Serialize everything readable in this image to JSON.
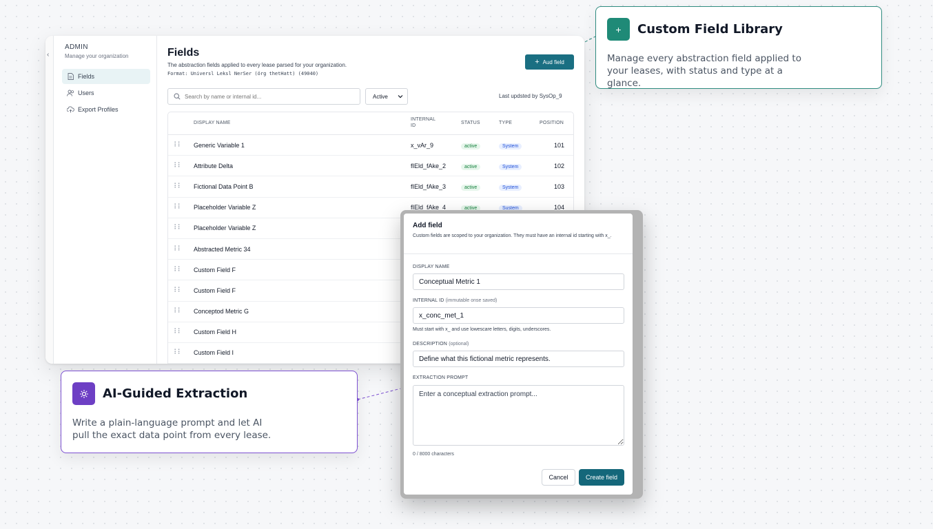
{
  "sidebar": {
    "title": "ADMIN",
    "subtitle": "Manage your organization",
    "items": [
      {
        "label": "Fields",
        "icon": "document-icon"
      },
      {
        "label": "Users",
        "icon": "users-icon"
      },
      {
        "label": "Export Profiles",
        "icon": "cloud-export-icon"
      }
    ]
  },
  "page": {
    "title": "Fields",
    "description": "The abstraction fields applied to every lease parsed for your organization.",
    "format": "Format: Universl Leksl NerSer (örg thetHatt) (49040)",
    "add_button": "Aud field",
    "search_placeholder": "Search by name or internal id...",
    "filter_value": "Active",
    "last_updated": "Last updsted by SysOp_9"
  },
  "table": {
    "headers": {
      "name": "DISPLAY NAME",
      "internal_id_line1": "INTERNAL",
      "internal_id_line2": "ID",
      "status": "STATUS",
      "type": "TYPE",
      "position": "POSITION"
    },
    "rows": [
      {
        "name": "Generic Variable 1",
        "id": "x_vAr_9",
        "status": "active",
        "type": "System",
        "position": "101"
      },
      {
        "name": "Attribute Delta",
        "id": "fIEld_fAke_2",
        "status": "active",
        "type": "System",
        "position": "102"
      },
      {
        "name": "Fictional Data Point B",
        "id": "fIEld_fAke_3",
        "status": "active",
        "type": "System",
        "position": "103"
      },
      {
        "name": "Placeholder Variable Z",
        "id": "fIEld_fAke_4",
        "status": "active",
        "type": "Sustem",
        "position": "104"
      },
      {
        "name": "Placeholder Variable Z",
        "id": "",
        "status": "",
        "type": "",
        "position": ""
      },
      {
        "name": "Abstracted Metric 34",
        "id": "",
        "status": "",
        "type": "",
        "position": ""
      },
      {
        "name": "Custom Field F",
        "id": "",
        "status": "",
        "type": "",
        "position": ""
      },
      {
        "name": "Custom Field F",
        "id": "",
        "status": "",
        "type": "",
        "position": ""
      },
      {
        "name": "Conceptod Metric G",
        "id": "",
        "status": "",
        "type": "",
        "position": ""
      },
      {
        "name": "Custom Field H",
        "id": "",
        "status": "",
        "type": "",
        "position": ""
      },
      {
        "name": "Custom Field I",
        "id": "",
        "status": "",
        "type": "",
        "position": ""
      }
    ]
  },
  "callouts": {
    "library": {
      "title": "Custom Field Library",
      "text": "Manage every abstraction field applied to your leases, with status and type at a glance.",
      "color": "#1f8a77"
    },
    "extraction": {
      "title": "AI-Guided Extraction",
      "text": "Write a plain-language prompt and let AI pull the exact data point from every lease.",
      "color": "#6d3fc4"
    }
  },
  "modal": {
    "title": "Add field",
    "subtitle": "Custom fields are scoped to your organization. They must have an internal id starting with x_.",
    "display_name_label": "DISPLAY NAME",
    "display_name_value": "Conceptual Metric 1",
    "internal_id_label": "INTERNAL ID",
    "internal_id_note": "(immutable onse saved)",
    "internal_id_value": "x_conc_met_1",
    "internal_id_hint": "Must start with x_ and use lowescare letters, digits, underscores.",
    "description_label": "DESCRIPTION",
    "description_note": "(optional)",
    "description_value": "Define what this fictional metric represents.",
    "prompt_label": "EXTRACTION PROMPT",
    "prompt_placeholder": "Enter a conceptual extraction prompt...",
    "char_count": "0 / 8000 characters",
    "cancel_label": "Cancel",
    "create_label": "Create field"
  },
  "colors": {
    "accent": "#1a6f82",
    "status_active_bg": "#e7f6ec",
    "type_bg": "#e8efff"
  }
}
